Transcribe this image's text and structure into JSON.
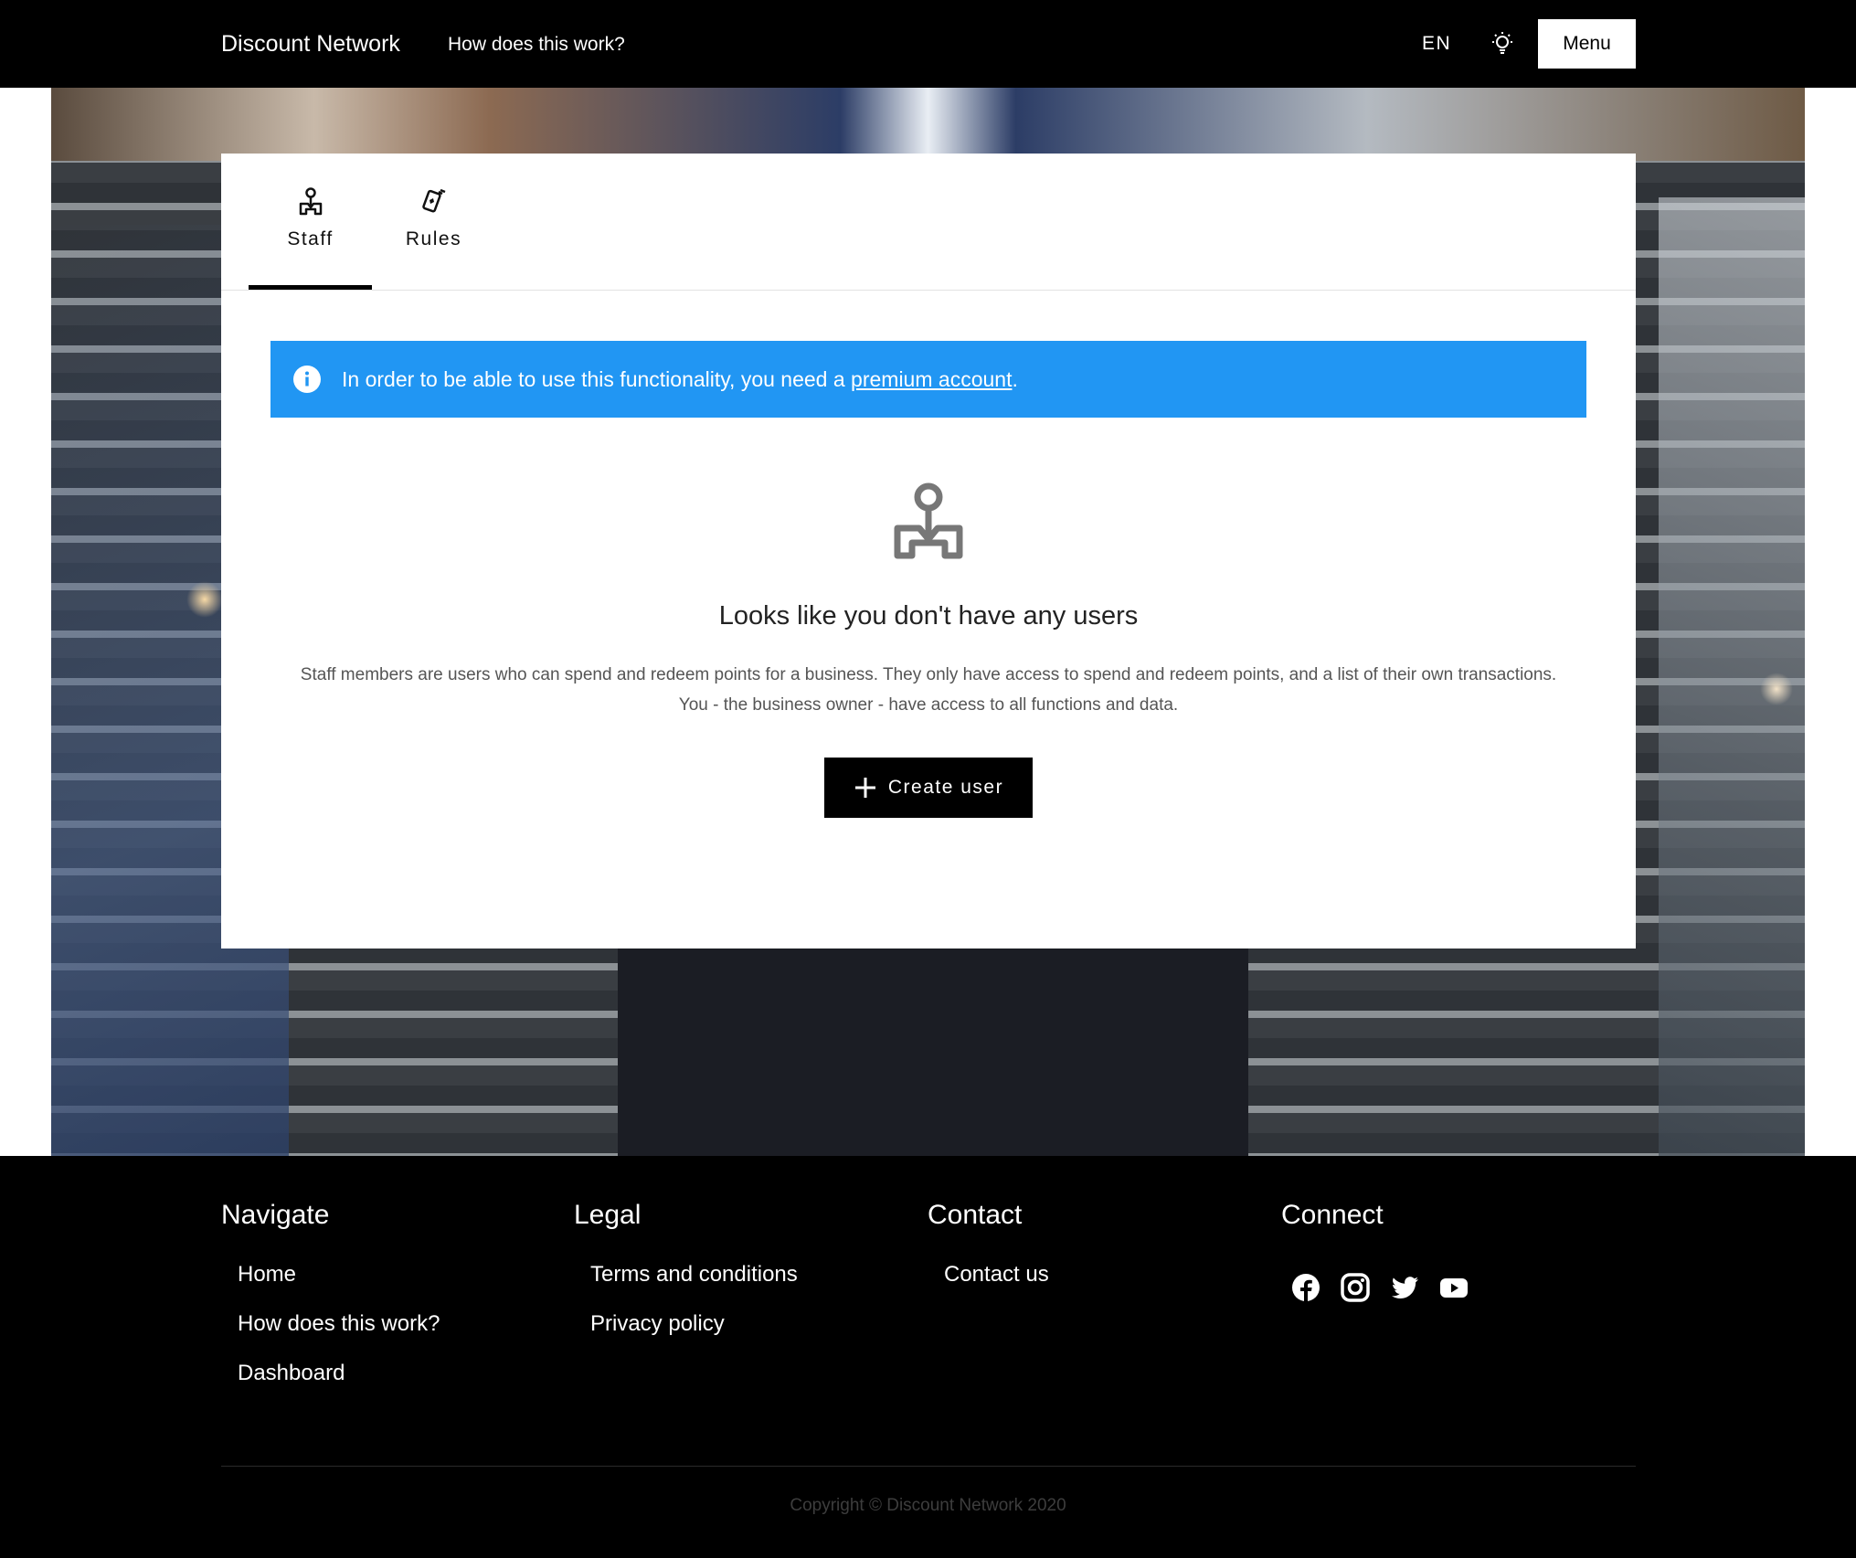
{
  "header": {
    "brand": "Discount Network",
    "how_link": "How does this work?",
    "language": "EN",
    "menu_label": "Menu"
  },
  "tabs": [
    {
      "label": "Staff",
      "icon": "staff-icon",
      "active": true
    },
    {
      "label": "Rules",
      "icon": "cards-icon",
      "active": false
    }
  ],
  "alert": {
    "prefix": "In order to be able to use this functionality, you need a ",
    "link": "premium account",
    "suffix": ".",
    "icon": "info-icon",
    "color": "#2196f3"
  },
  "empty_state": {
    "icon": "staff-icon",
    "title": "Looks like you don't have any users",
    "description": "Staff members are users who can spend and redeem points for a business. They only have access to spend and redeem points, and a list of their own transactions. You - the business owner - have access to all functions and data.",
    "button_label": "Create user"
  },
  "footer": {
    "navigate": {
      "title": "Navigate",
      "items": [
        "Home",
        "How does this work?",
        "Dashboard"
      ]
    },
    "legal": {
      "title": "Legal",
      "items": [
        "Terms and conditions",
        "Privacy policy"
      ]
    },
    "contact": {
      "title": "Contact",
      "items": [
        "Contact us"
      ]
    },
    "connect": {
      "title": "Connect",
      "icons": [
        "facebook-icon",
        "instagram-icon",
        "twitter-icon",
        "youtube-icon"
      ]
    },
    "copyright": "Copyright © Discount Network 2020"
  }
}
